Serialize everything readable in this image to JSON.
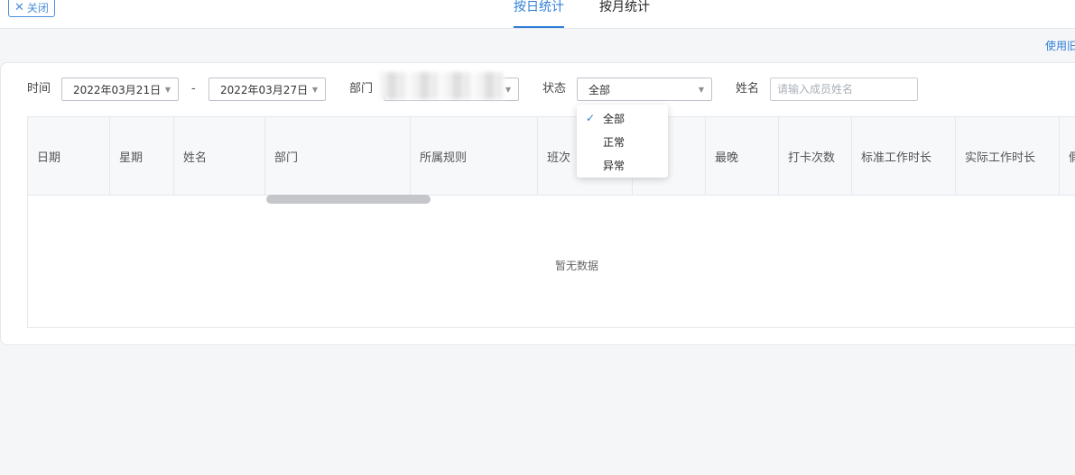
{
  "header": {
    "close_label": "关闭",
    "tabs": [
      {
        "label": "按日统计",
        "active": true
      },
      {
        "label": "按月统计",
        "active": false
      }
    ],
    "use_link": "使用旧"
  },
  "filters": {
    "time_label": "时间",
    "start_date": "2022年03月21日",
    "separator": "-",
    "end_date": "2022年03月27日",
    "dept_label": "部门",
    "dept_value": "",
    "status_label": "状态",
    "status_value": "全部",
    "name_label": "姓名",
    "name_placeholder": "请输入成员姓名",
    "name_value": ""
  },
  "status_dropdown": {
    "options": [
      "全部",
      "正常",
      "异常"
    ],
    "selected": "全部"
  },
  "table": {
    "columns": [
      "日期",
      "星期",
      "姓名",
      "部门",
      "所属规则",
      "班次",
      "",
      "最晚",
      "打卡次数",
      "标准工作时长",
      "实际工作时长",
      "假"
    ],
    "empty_text": "暂无数据"
  },
  "colors": {
    "accent": "#2f7fd6",
    "border": "#e6e8eb",
    "background": "#f5f6f8"
  }
}
